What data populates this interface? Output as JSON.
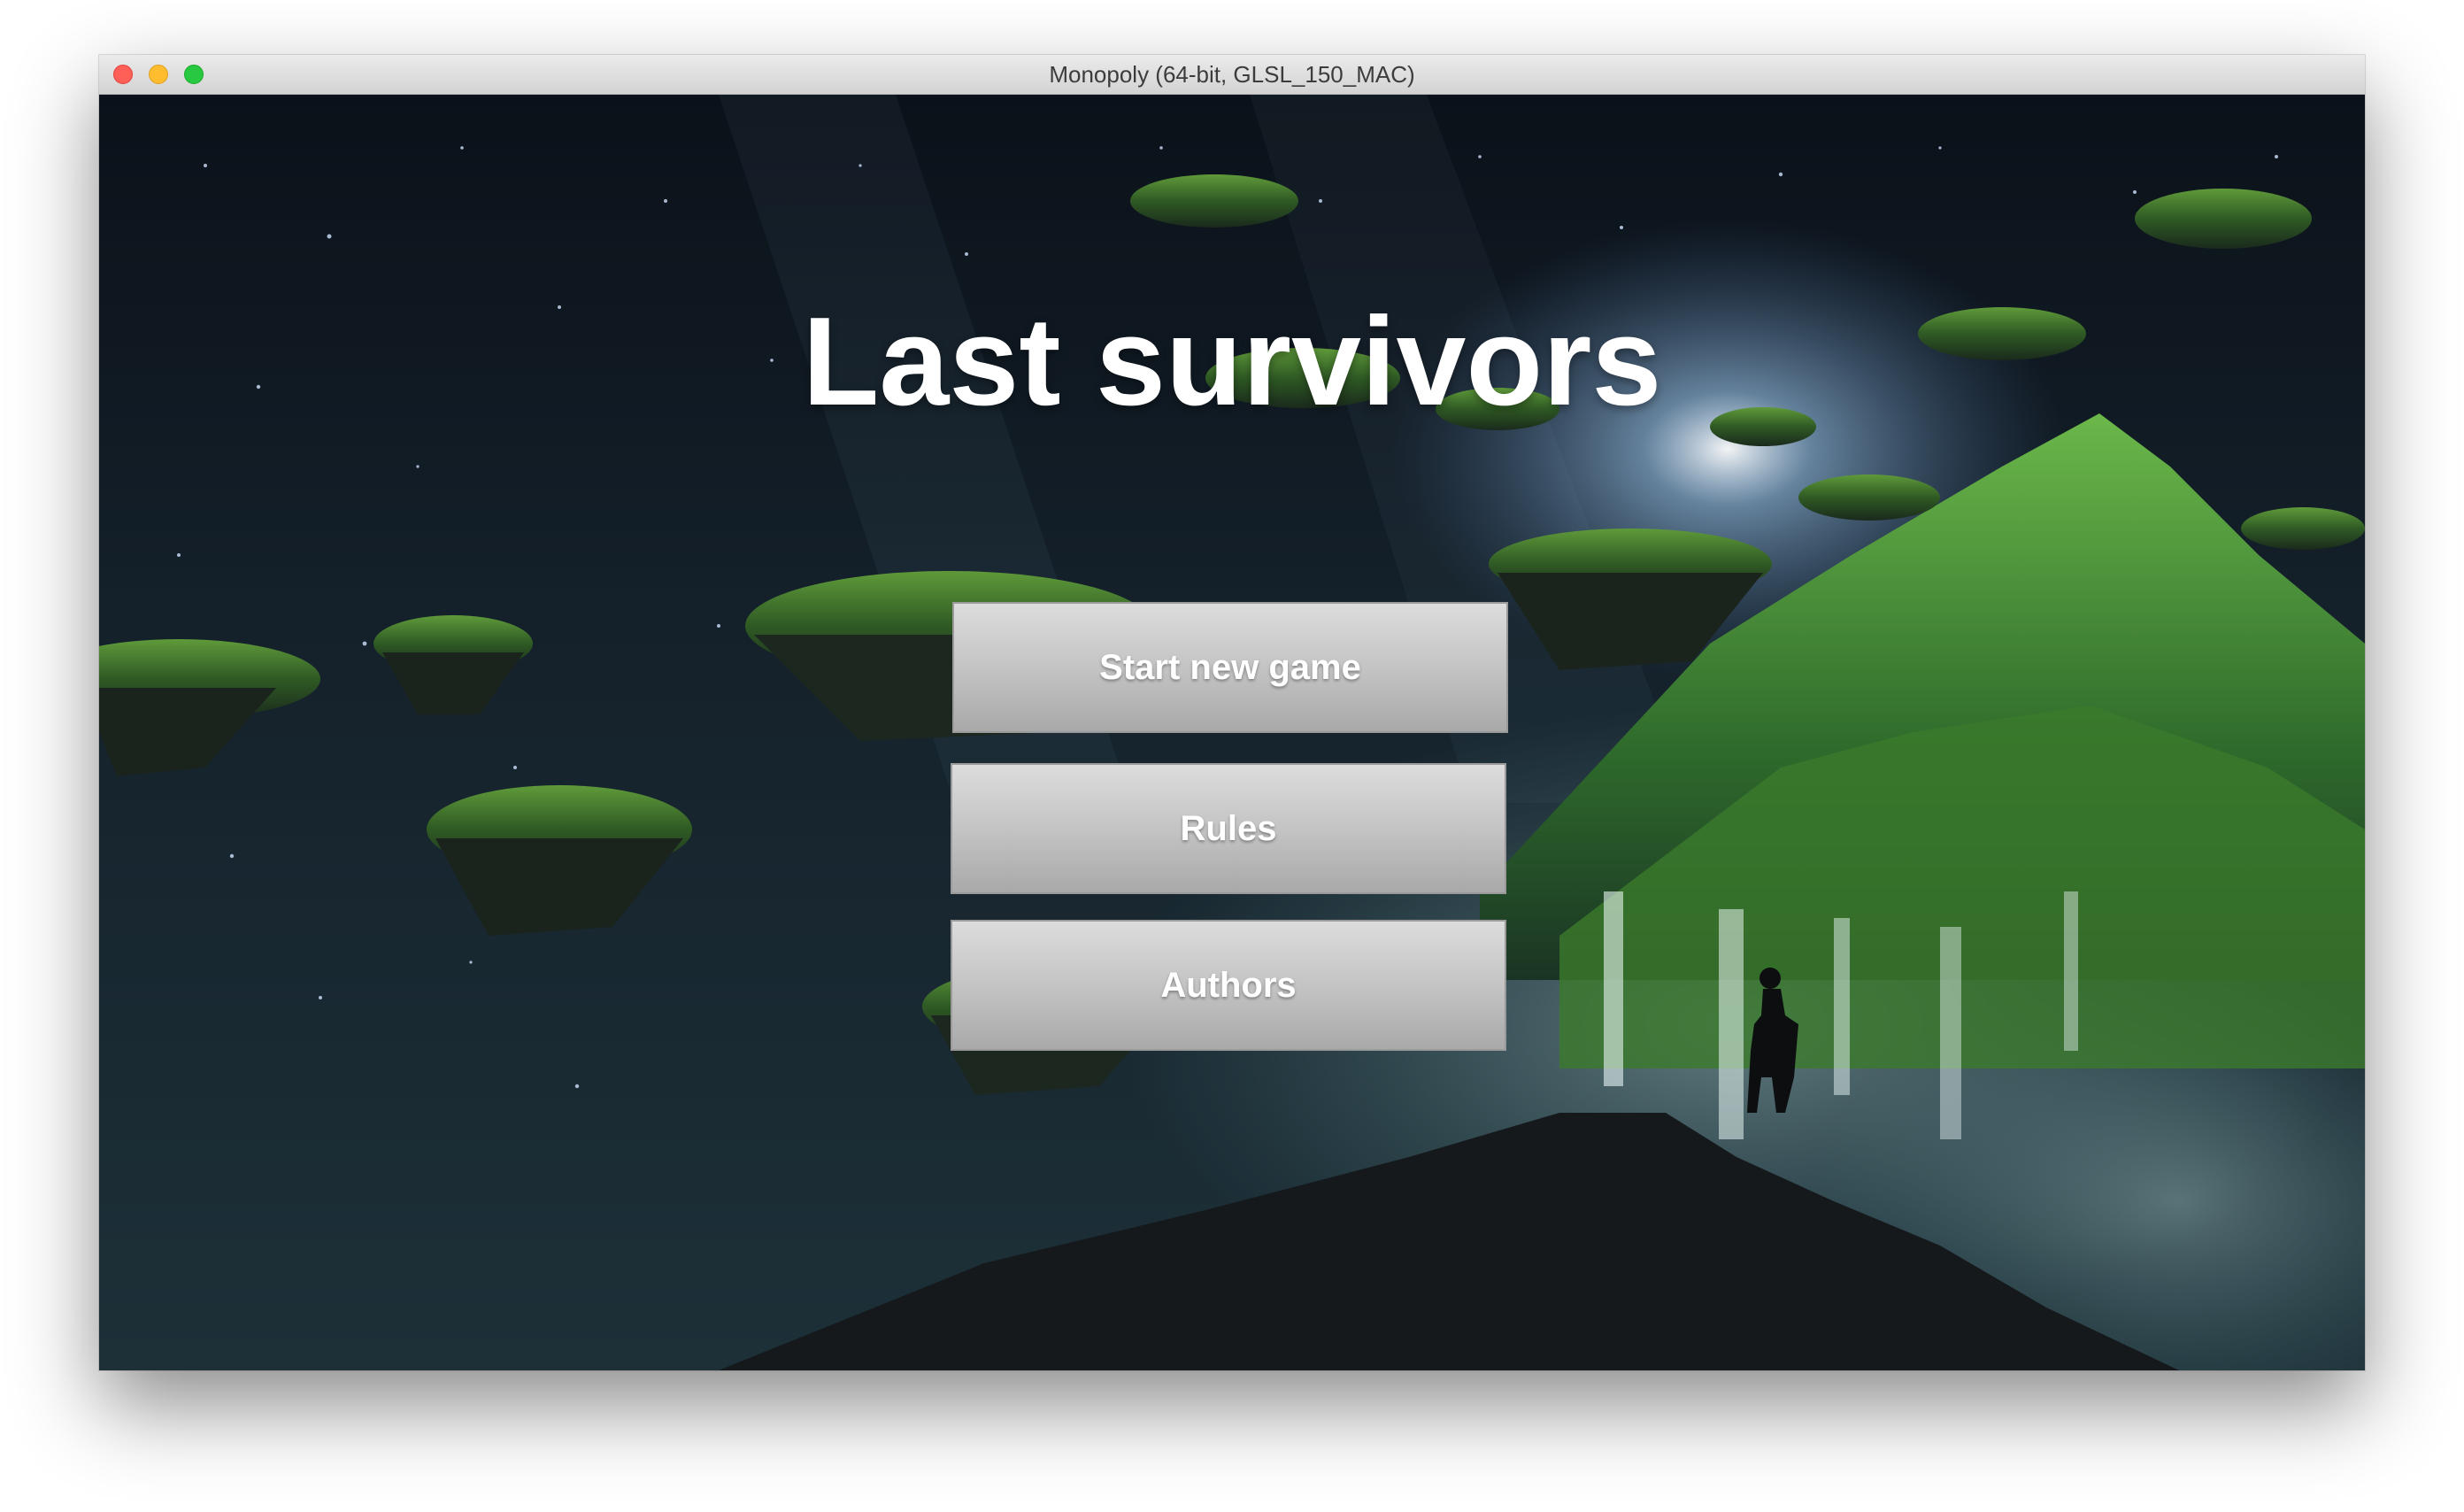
{
  "window": {
    "title": "Monopoly (64-bit, GLSL_150_MAC)"
  },
  "game": {
    "title": "Last survivors"
  },
  "menu": {
    "start_label": "Start new game",
    "rules_label": "Rules",
    "authors_label": "Authors"
  },
  "colors": {
    "button_top": "#dcdcdc",
    "button_bottom": "#a9a9a9",
    "title_text": "#ffffff",
    "sky_dark": "#0c1420",
    "foliage_green": "#3f7a2c"
  }
}
